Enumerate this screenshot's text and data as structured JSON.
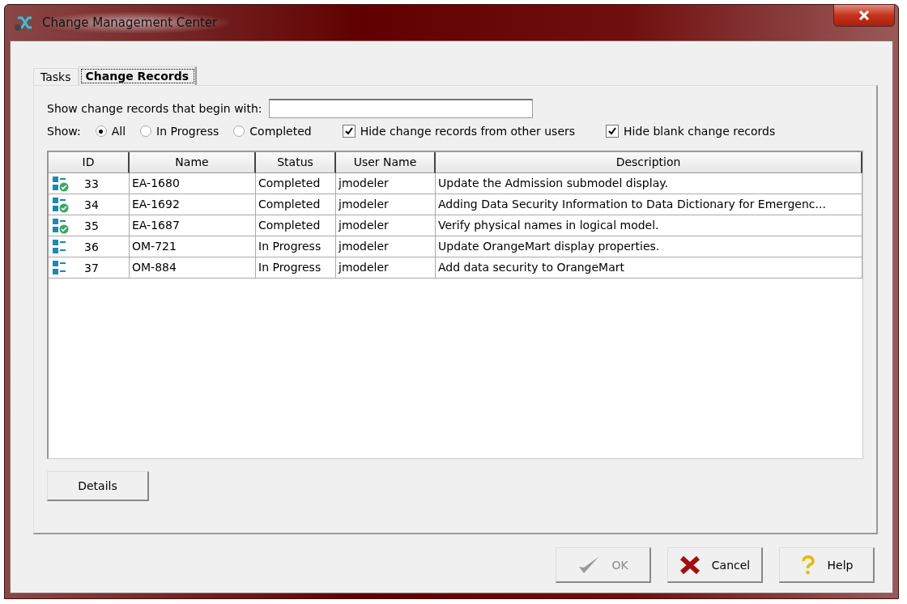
{
  "window": {
    "title": "Change Management Center"
  },
  "tabs": [
    {
      "label": "Tasks",
      "selected": false
    },
    {
      "label": "Change Records",
      "selected": true
    }
  ],
  "filter": {
    "label": "Show change records that begin with:"
  },
  "show": {
    "label": "Show:",
    "options": [
      {
        "label": "All",
        "selected": true
      },
      {
        "label": "In Progress",
        "selected": false
      },
      {
        "label": "Completed",
        "selected": false
      }
    ]
  },
  "checkboxes": [
    {
      "label": "Hide change records from other users",
      "checked": true
    },
    {
      "label": "Hide blank change records",
      "checked": true
    }
  ],
  "table": {
    "columns": [
      "ID",
      "Name",
      "Status",
      "User Name",
      "Description"
    ],
    "rows": [
      {
        "kind": "completed",
        "id": "33",
        "name": "EA-1680",
        "status": "Completed",
        "user": "jmodeler",
        "description": "Update the Admission submodel display."
      },
      {
        "kind": "completed",
        "id": "34",
        "name": "EA-1692",
        "status": "Completed",
        "user": "jmodeler",
        "description": "Adding Data Security Information to Data Dictionary for Emergenc..."
      },
      {
        "kind": "completed",
        "id": "35",
        "name": "EA-1687",
        "status": "Completed",
        "user": "jmodeler",
        "description": "Verify physical names in logical model."
      },
      {
        "kind": "progress",
        "id": "36",
        "name": "OM-721",
        "status": "In Progress",
        "user": "jmodeler",
        "description": "Update OrangeMart display properties."
      },
      {
        "kind": "progress",
        "id": "37",
        "name": "OM-884",
        "status": "In Progress",
        "user": "jmodeler",
        "description": "Add data security to OrangeMart"
      }
    ]
  },
  "details_button": "Details",
  "buttons": [
    {
      "kind": "ok",
      "label": "OK",
      "disabled": true
    },
    {
      "kind": "cancel",
      "label": "Cancel",
      "disabled": false
    },
    {
      "kind": "help",
      "label": "Help",
      "disabled": false
    }
  ]
}
